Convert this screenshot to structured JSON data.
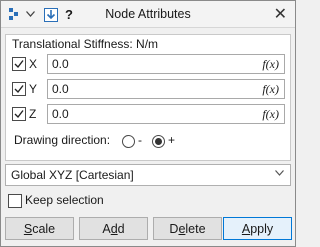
{
  "window": {
    "title": "Node Attributes",
    "close_label": "✕"
  },
  "toolbar": {
    "help_label": "?"
  },
  "stiffness": {
    "header": "Translational Stiffness: N/m",
    "rows": [
      {
        "axis": "X",
        "checked": true,
        "value": "0.0",
        "fx": "f(x)"
      },
      {
        "axis": "Y",
        "checked": true,
        "value": "0.0",
        "fx": "f(x)"
      },
      {
        "axis": "Z",
        "checked": true,
        "value": "0.0",
        "fx": "f(x)"
      }
    ],
    "direction_label": "Drawing direction:",
    "direction_options": [
      {
        "label": "-",
        "selected": false
      },
      {
        "label": "+",
        "selected": true
      }
    ]
  },
  "coordinate_system": {
    "selected": "Global XYZ [Cartesian]"
  },
  "keep_selection": {
    "label": "Keep selection",
    "checked": false
  },
  "buttons": {
    "scale": {
      "label": "Scale",
      "mnemonic_index": 0
    },
    "add": {
      "label": "Add",
      "mnemonic_index": 1
    },
    "delete": {
      "label": "Delete",
      "mnemonic_index": 1
    },
    "apply": {
      "label": "Apply",
      "mnemonic_index": 0
    }
  },
  "colors": {
    "accent": "#0078d7",
    "button_face": "#e1e1e1",
    "panel": "#ffffff",
    "window_bg": "#f0f0f0"
  }
}
